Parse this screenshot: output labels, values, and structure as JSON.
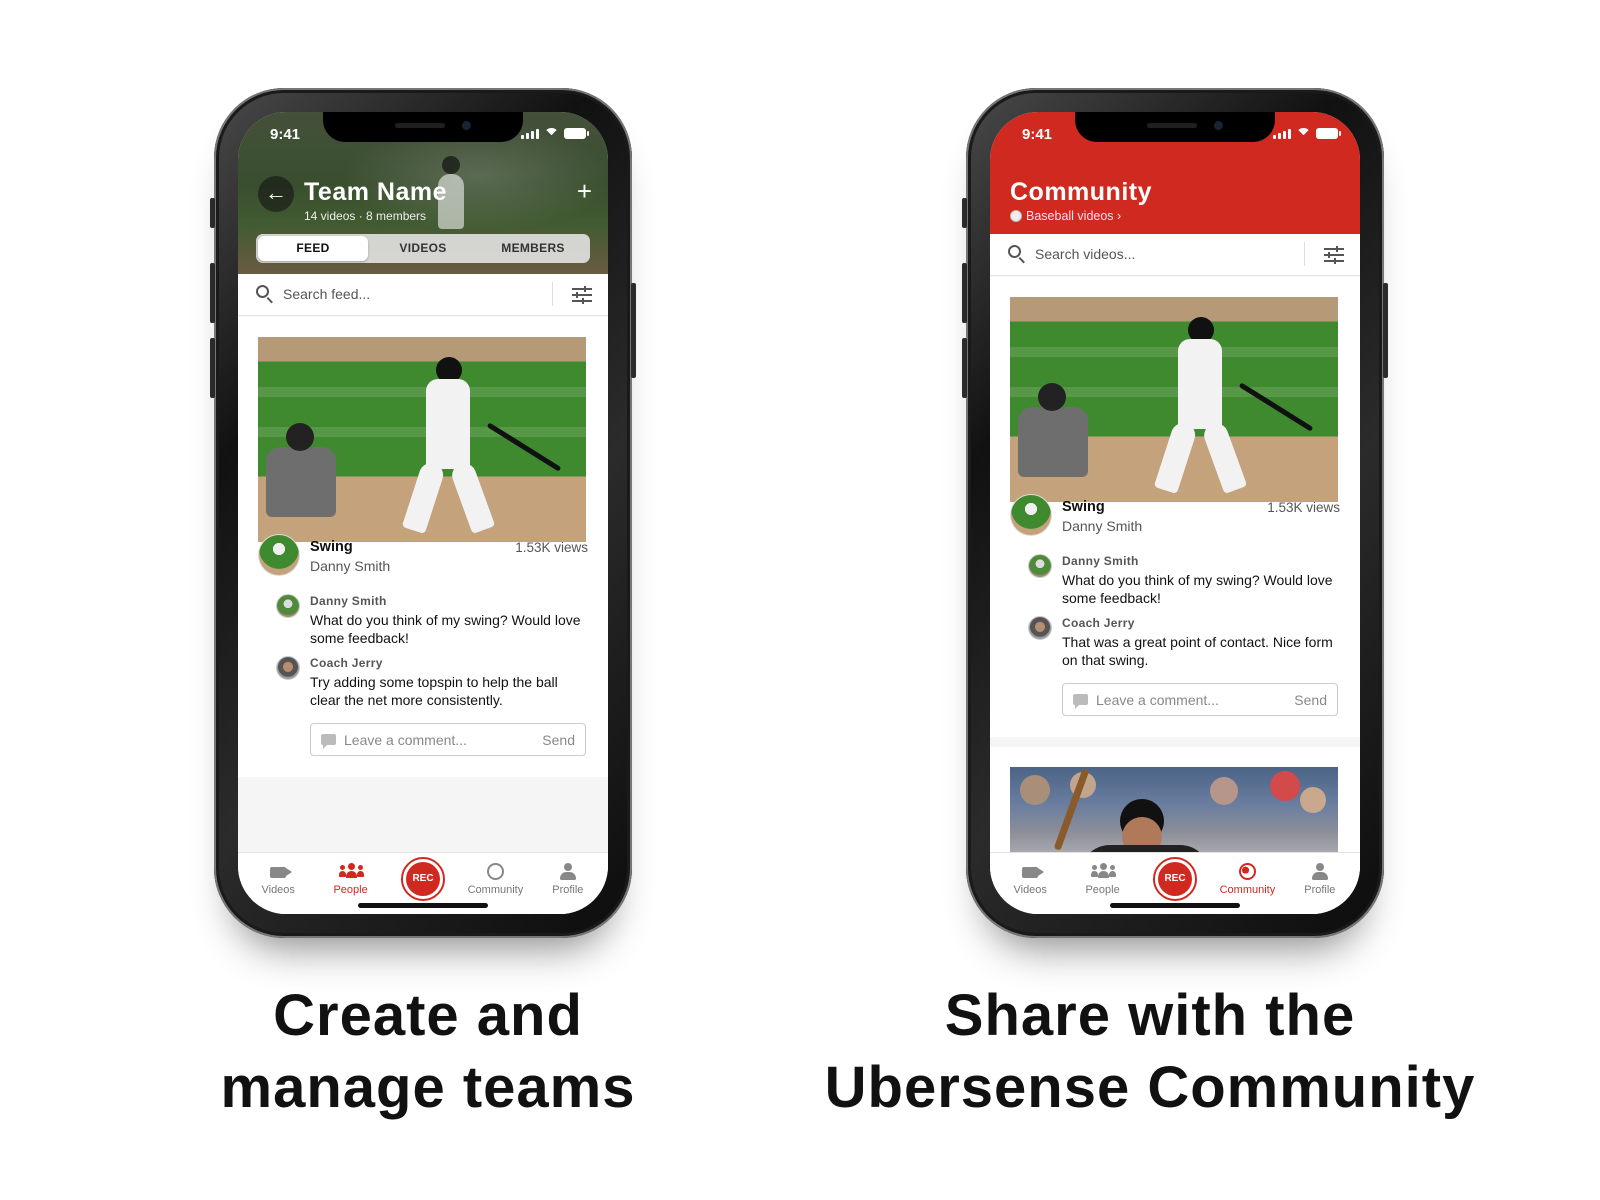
{
  "status_bar": {
    "time": "9:41"
  },
  "left_phone": {
    "header": {
      "title": "Team Name",
      "subtitle": "14 videos · 8 members",
      "back_icon": "arrow-left-icon",
      "add_icon": "plus-icon",
      "add_symbol": "+",
      "back_symbol": "←"
    },
    "segments": [
      {
        "label": "FEED",
        "active": true
      },
      {
        "label": "VIDEOS",
        "active": false
      },
      {
        "label": "MEMBERS",
        "active": false
      }
    ],
    "search": {
      "placeholder": "Search feed..."
    },
    "post": {
      "title": "Swing",
      "author": "Danny Smith",
      "views": "1.53K views",
      "comments": [
        {
          "name": "Danny Smith",
          "text": "What do you think of my swing? Would love some feedback!"
        },
        {
          "name": "Coach Jerry",
          "text": "Try adding some topspin to help the ball clear the net more consistently."
        }
      ],
      "comment_placeholder": "Leave a comment...",
      "send_label": "Send"
    },
    "tabbar": {
      "items": [
        {
          "label": "Videos",
          "icon": "video-camera-icon",
          "active": false
        },
        {
          "label": "People",
          "icon": "people-icon",
          "active": true
        },
        {
          "label": "REC",
          "icon": "record-button",
          "active": false
        },
        {
          "label": "Community",
          "icon": "globe-icon",
          "active": false
        },
        {
          "label": "Profile",
          "icon": "person-icon",
          "active": false
        }
      ]
    }
  },
  "right_phone": {
    "header": {
      "title": "Community",
      "subtitle": "Baseball videos",
      "subtitle_chevron": "›",
      "sport_icon": "baseball-icon"
    },
    "search": {
      "placeholder": "Search videos..."
    },
    "post": {
      "title": "Swing",
      "author": "Danny Smith",
      "views": "1.53K views",
      "comments": [
        {
          "name": "Danny Smith",
          "text": "What do you think of my swing? Would love some feedback!"
        },
        {
          "name": "Coach Jerry",
          "text": "That was a great point of contact. Nice form on that swing."
        }
      ],
      "comment_placeholder": "Leave a comment...",
      "send_label": "Send"
    },
    "tabbar": {
      "items": [
        {
          "label": "Videos",
          "icon": "video-camera-icon",
          "active": false
        },
        {
          "label": "People",
          "icon": "people-icon",
          "active": false
        },
        {
          "label": "REC",
          "icon": "record-button",
          "active": false
        },
        {
          "label": "Community",
          "icon": "globe-icon",
          "active": true
        },
        {
          "label": "Profile",
          "icon": "person-icon",
          "active": false
        }
      ]
    }
  },
  "captions": {
    "left_line1": "Create and",
    "left_line2": "manage teams",
    "right_line1": "Share with the",
    "right_line2": "Ubersense Community"
  },
  "colors": {
    "accent": "#d02a20",
    "text": "#111111",
    "muted": "#777777"
  }
}
